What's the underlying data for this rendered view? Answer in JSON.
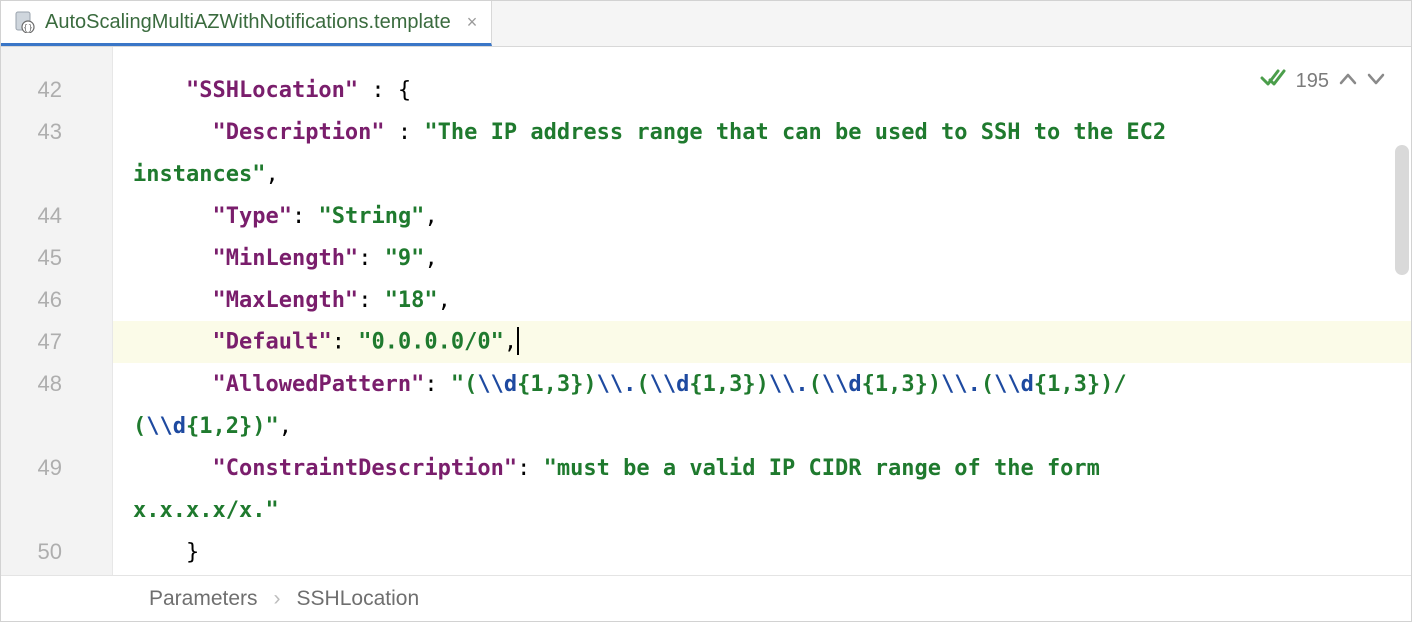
{
  "tab": {
    "filename": "AutoScalingMultiAZWithNotifications.template",
    "close_glyph": "×"
  },
  "inspection": {
    "count": "195"
  },
  "gutter": {
    "lines": [
      "42",
      "43",
      "",
      "44",
      "45",
      "46",
      "47",
      "48",
      "",
      "49",
      "",
      "50"
    ]
  },
  "code": {
    "lines": [
      {
        "indent": "    ",
        "segments": [
          {
            "t": "key",
            "v": "\"SSHLocation\""
          },
          {
            "t": "punct",
            "v": " : {"
          }
        ],
        "hl": false,
        "fold": "open"
      },
      {
        "indent": "      ",
        "segments": [
          {
            "t": "key",
            "v": "\"Description\""
          },
          {
            "t": "punct",
            "v": " : "
          },
          {
            "t": "str",
            "v": "\"The IP address range that can be used to SSH to the EC2 "
          }
        ],
        "hl": false
      },
      {
        "indent": "",
        "segments": [
          {
            "t": "str",
            "v": "instances\""
          },
          {
            "t": "punct",
            "v": ","
          }
        ],
        "hl": false,
        "cont": true
      },
      {
        "indent": "      ",
        "segments": [
          {
            "t": "key",
            "v": "\"Type\""
          },
          {
            "t": "punct",
            "v": ": "
          },
          {
            "t": "str",
            "v": "\"String\""
          },
          {
            "t": "punct",
            "v": ","
          }
        ],
        "hl": false
      },
      {
        "indent": "      ",
        "segments": [
          {
            "t": "key",
            "v": "\"MinLength\""
          },
          {
            "t": "punct",
            "v": ": "
          },
          {
            "t": "str",
            "v": "\"9\""
          },
          {
            "t": "punct",
            "v": ","
          }
        ],
        "hl": false
      },
      {
        "indent": "      ",
        "segments": [
          {
            "t": "key",
            "v": "\"MaxLength\""
          },
          {
            "t": "punct",
            "v": ": "
          },
          {
            "t": "str",
            "v": "\"18\""
          },
          {
            "t": "punct",
            "v": ","
          }
        ],
        "hl": false
      },
      {
        "indent": "      ",
        "segments": [
          {
            "t": "key",
            "v": "\"Default\""
          },
          {
            "t": "punct",
            "v": ": "
          },
          {
            "t": "str",
            "v": "\"0.0.0.0/0\""
          },
          {
            "t": "punct",
            "v": ","
          }
        ],
        "hl": true,
        "caret": true
      },
      {
        "indent": "      ",
        "segments": [
          {
            "t": "key",
            "v": "\"AllowedPattern\""
          },
          {
            "t": "punct",
            "v": ": "
          },
          {
            "t": "str",
            "v": "\"("
          },
          {
            "t": "esc",
            "v": "\\\\d"
          },
          {
            "t": "str",
            "v": "{1,3})"
          },
          {
            "t": "esc",
            "v": "\\\\."
          },
          {
            "t": "str",
            "v": "("
          },
          {
            "t": "esc",
            "v": "\\\\d"
          },
          {
            "t": "str",
            "v": "{1,3})"
          },
          {
            "t": "esc",
            "v": "\\\\."
          },
          {
            "t": "str",
            "v": "("
          },
          {
            "t": "esc",
            "v": "\\\\d"
          },
          {
            "t": "str",
            "v": "{1,3})"
          },
          {
            "t": "esc",
            "v": "\\\\."
          },
          {
            "t": "str",
            "v": "("
          },
          {
            "t": "esc",
            "v": "\\\\d"
          },
          {
            "t": "str",
            "v": "{1,3})/"
          }
        ],
        "hl": false
      },
      {
        "indent": "",
        "segments": [
          {
            "t": "str",
            "v": "("
          },
          {
            "t": "esc",
            "v": "\\\\d"
          },
          {
            "t": "str",
            "v": "{1,2})\""
          },
          {
            "t": "punct",
            "v": ","
          }
        ],
        "hl": false,
        "cont": true
      },
      {
        "indent": "      ",
        "segments": [
          {
            "t": "key",
            "v": "\"ConstraintDescription\""
          },
          {
            "t": "punct",
            "v": ": "
          },
          {
            "t": "str",
            "v": "\"must be a valid IP CIDR range of the form "
          }
        ],
        "hl": false
      },
      {
        "indent": "",
        "segments": [
          {
            "t": "str",
            "v": "x.x.x.x/x.\""
          }
        ],
        "hl": false,
        "cont": true
      },
      {
        "indent": "    ",
        "segments": [
          {
            "t": "punct",
            "v": "}"
          }
        ],
        "hl": false,
        "fold": "close"
      }
    ]
  },
  "breadcrumb": {
    "items": [
      "Parameters",
      "SSHLocation"
    ],
    "sep": "›"
  }
}
